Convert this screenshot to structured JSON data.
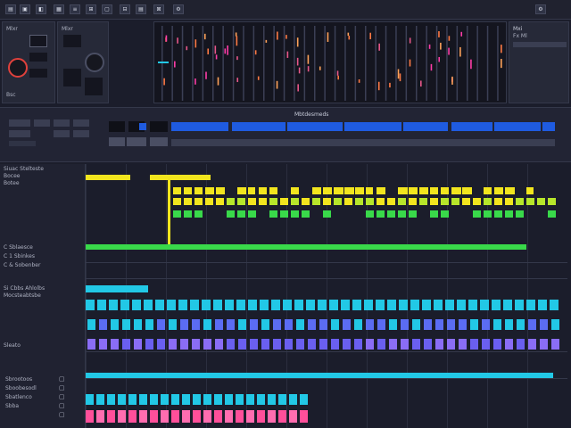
{
  "toolbar": {
    "buttons": [
      "▤",
      "▣",
      "◧",
      "▦",
      "≡",
      "⊞",
      "▢",
      "⊟",
      "▤",
      "⊠",
      "⚙"
    ]
  },
  "master_panel": {
    "label_left": "Mlxr",
    "label_small": "Bsc"
  },
  "right_panel": {
    "title": "Mxi",
    "subtitle": "Fx Ml"
  },
  "timeline": {
    "header_label": "Mbtdesmeds"
  },
  "tracks": {
    "group1": {
      "title": "Siuac Stelteste",
      "sub1": "Bocee",
      "sub2": "Botee"
    },
    "group2": {
      "row1": "C Sblaesce",
      "row2": "C 1 Sbinkes",
      "row3": "C & Sobenber"
    },
    "group3": {
      "title": "Si Cbbs Ahlolbs",
      "sub1": "Mocsteabtsbe"
    },
    "group4": {
      "title": "Sleato"
    },
    "group5": {
      "rows": [
        "Sbrootoos",
        "Sboobesodl",
        "Sbatlenco",
        "Sbba"
      ]
    }
  },
  "colors": {
    "yellow": "#f2e51e",
    "green": "#39d94a",
    "cyan": "#22c8e6",
    "violet": "#6a5ff0",
    "pink": "#ff4f9a",
    "blue": "#1f5be0"
  }
}
